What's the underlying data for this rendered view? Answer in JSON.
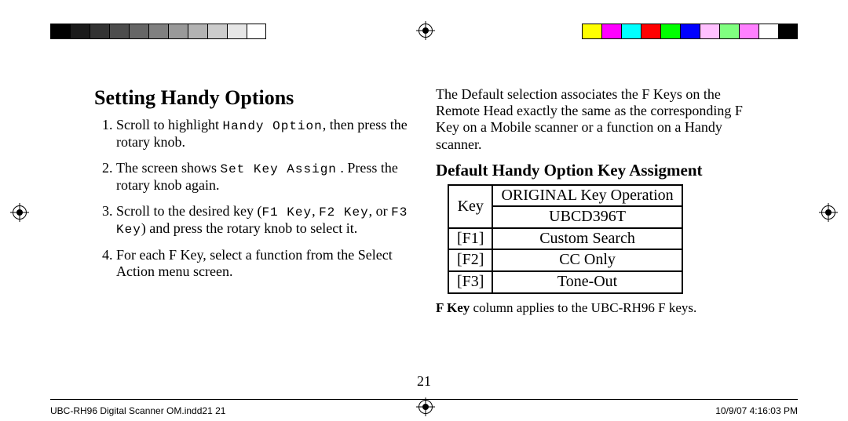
{
  "colorbars": {
    "left": [
      "#000000",
      "#1a1a1a",
      "#333333",
      "#4d4d4d",
      "#666666",
      "#808080",
      "#999999",
      "#b3b3b3",
      "#cccccc",
      "#e6e6e6",
      "#ffffff"
    ],
    "right": [
      "#ffff00",
      "#ff00ff",
      "#00ffff",
      "#ff0000",
      "#00ff00",
      "#0000ff",
      "#ffc0ff",
      "#80ff80",
      "#ff80ff",
      "#ffffff",
      "#000000"
    ]
  },
  "left_col": {
    "title": "Setting Handy Options",
    "steps": [
      {
        "pre": "Scroll to highlight ",
        "mono": "Handy Option",
        "post": ", then press the rotary knob."
      },
      {
        "pre": "The screen shows ",
        "mono": "Set Key Assign",
        "post": " . Press the rotary knob again."
      },
      {
        "pre": "Scroll to the desired key (",
        "mono": "F1 Key",
        "mid1": ", ",
        "mono2": "F2 Key",
        "mid2": ", or ",
        "mono3": "F3 Key",
        "post": ") and press the rotary knob to select it."
      },
      {
        "pre": "For each F Key, select a function from the Select Action menu screen."
      }
    ]
  },
  "right_col": {
    "intro": "The Default selection associates the F Keys on the Remote Head exactly the same as the corresponding F Key on a Mobile scanner or a function on a Handy scanner.",
    "subtitle": "Default Handy Option Key Assigment",
    "table": {
      "head_key": "Key",
      "head_op1": "ORIGINAL Key Operation",
      "head_op2": "UBCD396T",
      "rows": [
        {
          "key": "[F1]",
          "op": "Custom Search"
        },
        {
          "key": "[F2]",
          "op": "CC Only"
        },
        {
          "key": "[F3]",
          "op": "Tone-Out"
        }
      ]
    },
    "note_bold": "F Key",
    "note_rest": " column applies to the UBC-RH96 F keys."
  },
  "page_number": "21",
  "footer": {
    "left": "UBC-RH96 Digital Scanner OM.indd21   21",
    "right": "10/9/07   4:16:03 PM"
  }
}
